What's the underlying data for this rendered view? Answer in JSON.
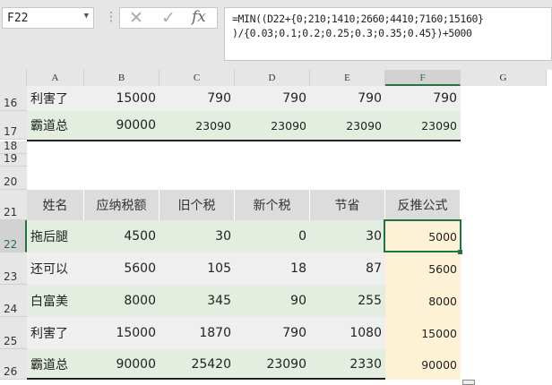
{
  "name_box": "F22",
  "formula_buttons": {
    "cancel": "✕",
    "enter": "✓",
    "fx": "fx"
  },
  "formula": "=MIN((D22+{0;210;1410;2660;4410;7160;15160}\n)/{0.03;0.1;0.2;0.25;0.3;0.35;0.45})+5000",
  "columns": [
    "A",
    "B",
    "C",
    "D",
    "E",
    "F",
    "G"
  ],
  "top_rows": [
    {
      "row": "16",
      "cells": [
        "利害了",
        "15000",
        "790",
        "790",
        "790",
        "790"
      ]
    },
    {
      "row": "17",
      "cells": [
        "霸道总",
        "90000",
        "23090",
        "23090",
        "23090",
        "23090"
      ]
    }
  ],
  "blank_rows": [
    "18",
    "19",
    "20"
  ],
  "table": {
    "header_row": "21",
    "headers": [
      "姓名",
      "应纳税额",
      "旧个税",
      "新个税",
      "节省",
      "反推公式"
    ],
    "rows": [
      {
        "row": "22",
        "cells": [
          "拖后腿",
          "4500",
          "30",
          "0",
          "30",
          "5000"
        ]
      },
      {
        "row": "23",
        "cells": [
          "还可以",
          "5600",
          "105",
          "18",
          "87",
          "5600"
        ]
      },
      {
        "row": "24",
        "cells": [
          "白富美",
          "8000",
          "345",
          "90",
          "255",
          "8000"
        ]
      },
      {
        "row": "25",
        "cells": [
          "利害了",
          "15000",
          "1870",
          "790",
          "1080",
          "15000"
        ]
      },
      {
        "row": "26",
        "cells": [
          "霸道总",
          "90000",
          "25420",
          "23090",
          "2330",
          "90000"
        ]
      }
    ]
  },
  "colors": {
    "selection": "#217346",
    "green_band": "#e4eee0",
    "yellow_col": "#fdf1d6"
  }
}
